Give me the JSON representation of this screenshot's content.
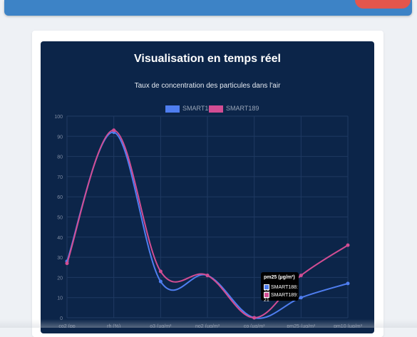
{
  "app": {
    "colors": {
      "topbar": "#3d83c6",
      "accent_button": "#e3564c",
      "panel": "#0c2549"
    }
  },
  "panel": {
    "title": "Visualisation en temps réel"
  },
  "chart_data": {
    "type": "line",
    "title": "Taux de concentration des particules dans l'air",
    "categories": [
      "co2 (ppm)",
      "rh (%)",
      "o3 (µg/m³)",
      "no2 (µg/m³)",
      "co (µg/m³)",
      "pm25 (µg/m³)",
      "pm10 (µg/m³)"
    ],
    "category_labels_visible": [
      "co2 (pp",
      "rh (%)",
      "o3 (µg/m³",
      "no2 (µg/m³",
      "co (µg/m³",
      "pm25 (µg/m³",
      "pm10 (µg/m³"
    ],
    "series": [
      {
        "name": "SMART188",
        "color": "#4f7ef0",
        "values": [
          28,
          92,
          18,
          21,
          0,
          10,
          17
        ]
      },
      {
        "name": "SMART189",
        "color": "#d24d93",
        "values": [
          27,
          93,
          23,
          21,
          0,
          21,
          36
        ]
      }
    ],
    "ylim": [
      0,
      100
    ],
    "yticks": [
      0,
      10,
      20,
      30,
      40,
      50,
      60,
      70,
      80,
      90,
      100
    ],
    "legend_position": "top",
    "grid": true,
    "tooltip": {
      "title": "pm25 (µg/m³)",
      "lines": [
        "SMART188: 10",
        "SMART189: 21"
      ],
      "category_index": 5
    }
  }
}
